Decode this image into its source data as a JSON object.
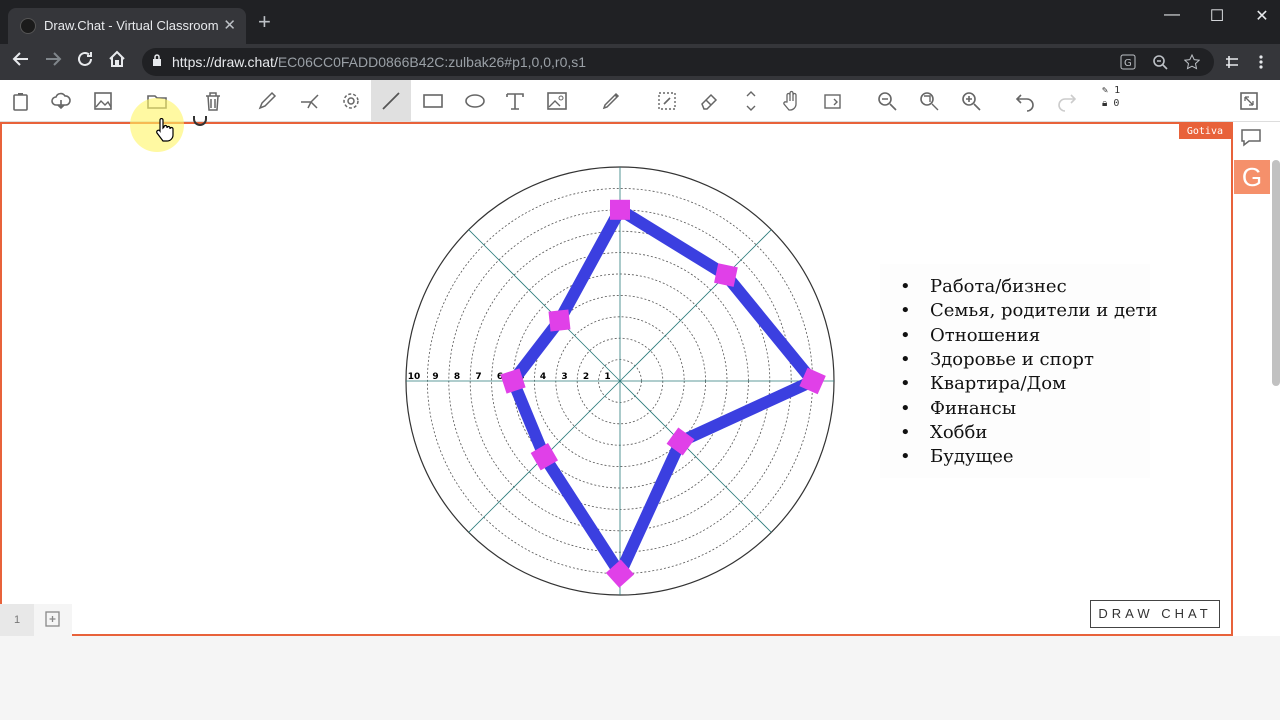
{
  "browser": {
    "tab_title": "Draw.Chat - Virtual Classroom",
    "tab_close": "✕",
    "new_tab": "+",
    "url_host": "https://draw.chat/",
    "url_path": "EC06CC0FADD0866B42C:zulbak26#p1,0,0,r0,s1",
    "win_min": "—",
    "win_max": "☐",
    "win_close": "✕"
  },
  "toolbar": {
    "edits_count": "1",
    "locks_count": "0",
    "tools": [
      "upload-icon",
      "cloud-icon",
      "image-icon",
      "folder-icon",
      "trash-icon",
      "pencil-icon",
      "laser-icon",
      "settings-icon",
      "line-icon",
      "rectangle-icon",
      "ellipse-icon",
      "text-icon",
      "picture-icon",
      "highlighter-icon",
      "select-icon",
      "eraser-icon",
      "hand-icon",
      "rotate-icon",
      "zoom-out-icon",
      "zoom-fit-icon",
      "zoom-in-icon",
      "undo-icon",
      "redo-icon"
    ],
    "active_tool": "line-icon"
  },
  "canvas": {
    "user_badge": "Gotiva",
    "side_letter": "G",
    "page_number": "1",
    "brand": "DRAW CHAT"
  },
  "legend": {
    "bullet": "•",
    "items": [
      "Работа/бизнес",
      "Семья, родители и дети",
      "Отношения",
      "Здоровье и спорт",
      "Квартира/Дом",
      "Финансы",
      "Хобби",
      "Будущее"
    ]
  },
  "wheel": {
    "axis_labels": [
      "10",
      "9",
      "8",
      "7",
      "6",
      "5",
      "4",
      "3",
      "2",
      "1"
    ],
    "rings": 10,
    "spokes": 8,
    "stroke_color": "#3b3fe0",
    "marker_color": "#e040e8",
    "points": [
      8,
      7,
      9,
      4,
      9,
      5,
      5,
      4
    ]
  },
  "colors": {
    "accent": "#e8623a",
    "tabbar": "#202124"
  }
}
